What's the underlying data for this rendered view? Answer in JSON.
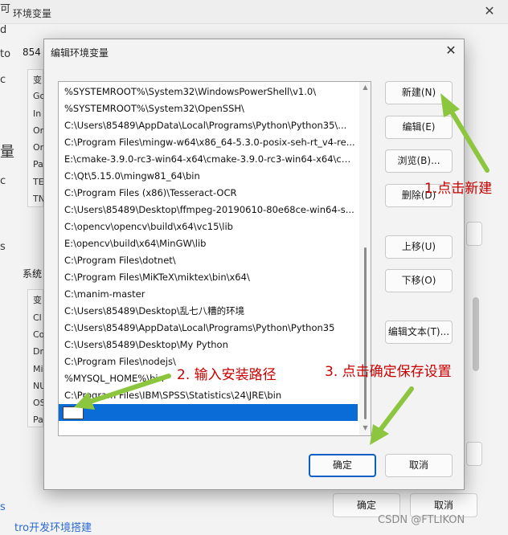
{
  "background_window": {
    "title": "环境变量",
    "left_edge_chars": [
      "可",
      "d",
      "to",
      "c",
      "量",
      "c",
      "s",
      "s",
      "tro"
    ],
    "user_vars_header_prefix": "854",
    "user_list_chars": [
      "变",
      "Go",
      "In",
      "On",
      "On",
      "Pa",
      "TE",
      "TN"
    ],
    "system_group_label": "系统",
    "system_list_chars": [
      "变",
      "Cl",
      "Co",
      "Dr",
      "Mi",
      "NU",
      "OS",
      "Pa"
    ],
    "ok_button": "确定",
    "cancel_button": "取消",
    "bottom_link_text": "tro开发环境搭建"
  },
  "dialog": {
    "title": "编辑环境变量",
    "entries": [
      "%SYSTEMROOT%\\System32\\WindowsPowerShell\\v1.0\\",
      "%SYSTEMROOT%\\System32\\OpenSSH\\",
      "C:\\Users\\85489\\AppData\\Local\\Programs\\Python\\Python35\\...",
      "C:\\Program Files\\mingw-w64\\x86_64-5.3.0-posix-seh-rt_v4-re...",
      "E:\\cmake-3.9.0-rc3-win64-x64\\cmake-3.9.0-rc3-win64-x64\\cm...",
      "C:\\Qt\\5.15.0\\mingw81_64\\bin",
      "C:\\Program Files (x86)\\Tesseract-OCR",
      "C:\\Users\\85489\\Desktop\\ffmpeg-20190610-80e68ce-win64-s...",
      "C:\\opencv\\opencv\\build\\x64\\vc15\\lib",
      "E:\\opencv\\build\\x64\\MinGW\\lib",
      "C:\\Program Files\\dotnet\\",
      "C:\\Program Files\\MiKTeX\\miktex\\bin\\x64\\",
      "C:\\manim-master",
      "C:\\Users\\85489\\Desktop\\乱七八糟的环境",
      "C:\\Users\\85489\\AppData\\Local\\Programs\\Python\\Python35",
      "C:\\Users\\85489\\Desktop\\My Python",
      "C:\\Program Files\\nodejs\\",
      "%MYSQL_HOME%\\bin",
      "C:\\Program Files\\IBM\\SPSS\\Statistics\\24\\JRE\\bin",
      ""
    ],
    "buttons": {
      "new": "新建(N)",
      "edit": "编辑(E)",
      "browse": "浏览(B)...",
      "delete": "删除(D)",
      "move_up": "上移(U)",
      "move_down": "下移(O)",
      "edit_text": "编辑文本(T)...",
      "ok": "确定",
      "cancel": "取消"
    }
  },
  "annotations": {
    "step1": "1.点击新建",
    "step2": "2. 输入安装路径",
    "step3": "3. 点击确定保存设置",
    "arrow_color": "#8cc63f",
    "text_color": "#c80000"
  },
  "watermark": "CSDN @FTLIKON",
  "colors": {
    "selection": "#0a6cd6",
    "primary_border": "#0a5fc4"
  }
}
